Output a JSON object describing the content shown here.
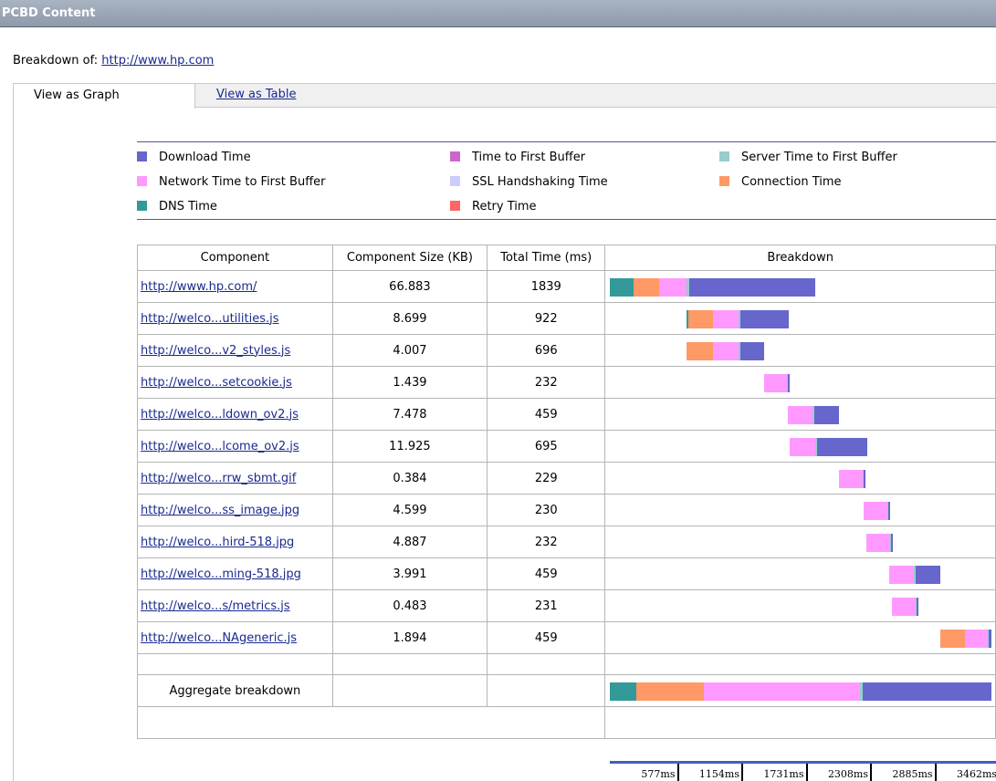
{
  "window": {
    "title": "PCBD Content"
  },
  "breakdown": {
    "label": "Breakdown of:",
    "url": "http://www.hp.com"
  },
  "tabs": [
    {
      "label": "View as Graph",
      "active": true
    },
    {
      "label": "View as Table",
      "active": false
    }
  ],
  "legend": [
    {
      "label": "Download Time",
      "color": "#6666cc"
    },
    {
      "label": "Time to First Buffer",
      "color": "#cc66cc"
    },
    {
      "label": "Server Time to First Buffer",
      "color": "#99cccc"
    },
    {
      "label": "Network Time to First Buffer",
      "color": "#ff99ff"
    },
    {
      "label": "SSL Handshaking Time",
      "color": "#ccccff"
    },
    {
      "label": "Connection Time",
      "color": "#ff9966"
    },
    {
      "label": "DNS Time",
      "color": "#339999"
    },
    {
      "label": "Retry Time",
      "color": "#ff6666"
    }
  ],
  "table": {
    "headers": {
      "component": "Component",
      "size": "Component Size (KB)",
      "time": "Total Time (ms)",
      "breakdown": "Breakdown"
    },
    "rows": [
      {
        "component": "http://www.hp.com/",
        "size": "66.883",
        "time": "1839",
        "segments": [
          {
            "type": "dns",
            "start": 0,
            "end": 208
          },
          {
            "type": "connection",
            "start": 208,
            "end": 440
          },
          {
            "type": "network",
            "start": 440,
            "end": 683
          },
          {
            "type": "server",
            "start": 683,
            "end": 709
          },
          {
            "type": "download",
            "start": 709,
            "end": 1839
          }
        ]
      },
      {
        "component": "http://welco...utilities.js",
        "size": "8.699",
        "time": "922",
        "segments": [
          {
            "type": "dns",
            "start": 680,
            "end": 697
          },
          {
            "type": "connection",
            "start": 697,
            "end": 920
          },
          {
            "type": "network",
            "start": 920,
            "end": 1150
          },
          {
            "type": "server",
            "start": 1150,
            "end": 1170
          },
          {
            "type": "download",
            "start": 1170,
            "end": 1602
          }
        ]
      },
      {
        "component": "http://welco...v2_styles.js",
        "size": "4.007",
        "time": "696",
        "segments": [
          {
            "type": "connection",
            "start": 680,
            "end": 920
          },
          {
            "type": "network",
            "start": 920,
            "end": 1150
          },
          {
            "type": "server",
            "start": 1150,
            "end": 1170
          },
          {
            "type": "download",
            "start": 1170,
            "end": 1376
          }
        ]
      },
      {
        "component": "http://welco...setcookie.js",
        "size": "1.439",
        "time": "232",
        "segments": [
          {
            "type": "network",
            "start": 1376,
            "end": 1586
          },
          {
            "type": "server",
            "start": 1586,
            "end": 1593
          },
          {
            "type": "download",
            "start": 1593,
            "end": 1608
          }
        ]
      },
      {
        "component": "http://welco...ldown_ov2.js",
        "size": "7.478",
        "time": "459",
        "segments": [
          {
            "type": "network",
            "start": 1593,
            "end": 1810
          },
          {
            "type": "server",
            "start": 1810,
            "end": 1827
          },
          {
            "type": "download",
            "start": 1827,
            "end": 2052
          }
        ]
      },
      {
        "component": "http://welco...lcome_ov2.js",
        "size": "11.925",
        "time": "695",
        "segments": [
          {
            "type": "network",
            "start": 1608,
            "end": 1836
          },
          {
            "type": "server",
            "start": 1836,
            "end": 1853
          },
          {
            "type": "download",
            "start": 1853,
            "end": 2303
          }
        ]
      },
      {
        "component": "http://welco...rrw_sbmt.gif",
        "size": "0.384",
        "time": "229",
        "segments": [
          {
            "type": "network",
            "start": 2052,
            "end": 2262
          },
          {
            "type": "server",
            "start": 2262,
            "end": 2270
          },
          {
            "type": "download",
            "start": 2270,
            "end": 2281
          }
        ]
      },
      {
        "component": "http://welco...ss_image.jpg",
        "size": "4.599",
        "time": "230",
        "segments": [
          {
            "type": "network",
            "start": 2270,
            "end": 2482
          },
          {
            "type": "server",
            "start": 2482,
            "end": 2490
          },
          {
            "type": "download",
            "start": 2490,
            "end": 2500
          }
        ]
      },
      {
        "component": "http://welco...hird-518.jpg",
        "size": "4.887",
        "time": "232",
        "segments": [
          {
            "type": "network",
            "start": 2295,
            "end": 2507
          },
          {
            "type": "server",
            "start": 2507,
            "end": 2515
          },
          {
            "type": "download",
            "start": 2515,
            "end": 2527
          }
        ]
      },
      {
        "component": "http://welco...ming-518.jpg",
        "size": "3.991",
        "time": "459",
        "segments": [
          {
            "type": "network",
            "start": 2500,
            "end": 2718
          },
          {
            "type": "server",
            "start": 2718,
            "end": 2736
          },
          {
            "type": "download",
            "start": 2736,
            "end": 2959
          }
        ]
      },
      {
        "component": "http://welco...s/metrics.js",
        "size": "0.483",
        "time": "231",
        "segments": [
          {
            "type": "network",
            "start": 2527,
            "end": 2738
          },
          {
            "type": "server",
            "start": 2738,
            "end": 2745
          },
          {
            "type": "download",
            "start": 2745,
            "end": 2758
          }
        ]
      },
      {
        "component": "http://welco...NAgeneric.js",
        "size": "1.894",
        "time": "459",
        "segments": [
          {
            "type": "connection",
            "start": 2959,
            "end": 3177
          },
          {
            "type": "network",
            "start": 3177,
            "end": 3385
          },
          {
            "type": "server",
            "start": 3385,
            "end": 3393
          },
          {
            "type": "download",
            "start": 3393,
            "end": 3418
          }
        ]
      }
    ],
    "aggregate": {
      "label": "Aggregate breakdown",
      "segments": [
        {
          "type": "dns",
          "start": 0,
          "end": 237
        },
        {
          "type": "connection",
          "start": 237,
          "end": 840
        },
        {
          "type": "network",
          "start": 840,
          "end": 2235
        },
        {
          "type": "server",
          "start": 2235,
          "end": 2262
        },
        {
          "type": "download",
          "start": 2262,
          "end": 3418
        }
      ]
    }
  },
  "axis": {
    "max_ms": 3462,
    "ticks": [
      "577ms",
      "1154ms",
      "1731ms",
      "2308ms",
      "2885ms",
      "3462ms"
    ],
    "tick_values": [
      577,
      1154,
      1731,
      2308,
      2885,
      3462
    ]
  },
  "colors": {
    "dns": "#339999",
    "connection": "#ff9966",
    "network": "#ff99ff",
    "server": "#99cccc",
    "download": "#6666cc",
    "ssl": "#ccccff",
    "retry": "#ff6666",
    "ttfb": "#cc66cc"
  }
}
